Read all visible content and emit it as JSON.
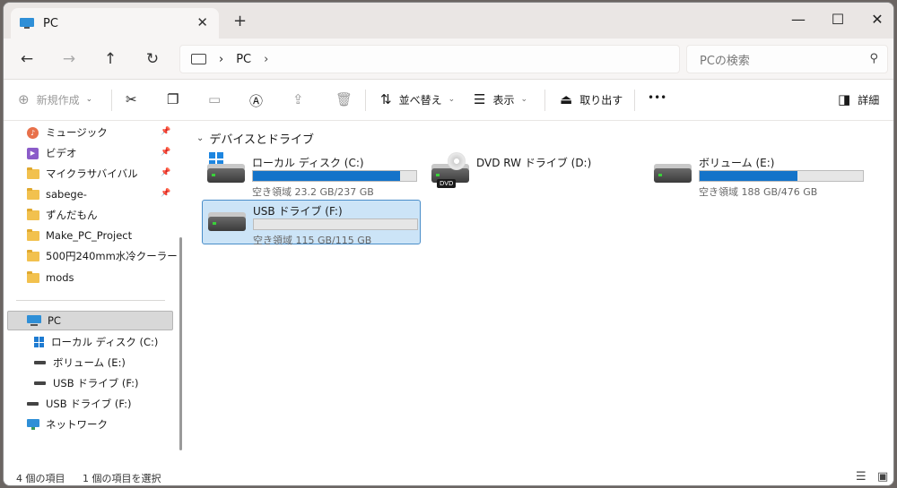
{
  "tab": {
    "title": "PC",
    "close": "✕",
    "new_tab": "+"
  },
  "window_controls": {
    "minimize": "—",
    "maximize": "☐",
    "close": "✕"
  },
  "nav": {
    "back": "←",
    "forward": "→",
    "up": "↑",
    "refresh": "↻"
  },
  "address": {
    "crumbs": [
      "PC"
    ],
    "sep": "›"
  },
  "search": {
    "placeholder": "PCの検索"
  },
  "toolbar": {
    "new": "新規作成",
    "sort": "並べ替え",
    "view": "表示",
    "eject": "取り出す",
    "more": "•••",
    "details": "詳細"
  },
  "sidebar": {
    "quick": [
      {
        "label": "ミュージック",
        "icon": "music-icon",
        "pinned": true
      },
      {
        "label": "ビデオ",
        "icon": "video-icon",
        "pinned": true
      },
      {
        "label": "マイクラサバイバル",
        "icon": "folder-icon",
        "pinned": true
      },
      {
        "label": "sabege-",
        "icon": "folder-icon",
        "pinned": true
      },
      {
        "label": "ずんだもん",
        "icon": "folder-icon",
        "pinned": false
      },
      {
        "label": "Make_PC_Project",
        "icon": "folder-icon",
        "pinned": false
      },
      {
        "label": "500円240mm水冷クーラー",
        "icon": "folder-icon",
        "pinned": false
      },
      {
        "label": "mods",
        "icon": "folder-icon",
        "pinned": false
      }
    ],
    "pc": "PC",
    "pc_children": [
      "ローカル ディスク (C:)",
      "ボリューム (E:)",
      "USB ドライブ (F:)"
    ],
    "usb": "USB ドライブ (F:)",
    "network": "ネットワーク"
  },
  "content": {
    "group": "デバイスとドライブ",
    "drives": [
      {
        "name": "ローカル ディスク (C:)",
        "space": "空き領域 23.2 GB/237 GB",
        "used_fraction": 0.9
      },
      {
        "name": "DVD RW ドライブ (D:)",
        "badge": "DVD"
      },
      {
        "name": "ボリューム (E:)",
        "space": "空き領域 188 GB/476 GB",
        "used_fraction": 0.6
      },
      {
        "name": "USB ドライブ (F:)",
        "space": "空き領域 115 GB/115 GB",
        "used_fraction": 0.0
      }
    ]
  },
  "status": {
    "count": "4 個の項目",
    "selected": "1 個の項目を選択"
  },
  "colors": {
    "accent": "#1473c9",
    "selection": "#cce4f7"
  }
}
